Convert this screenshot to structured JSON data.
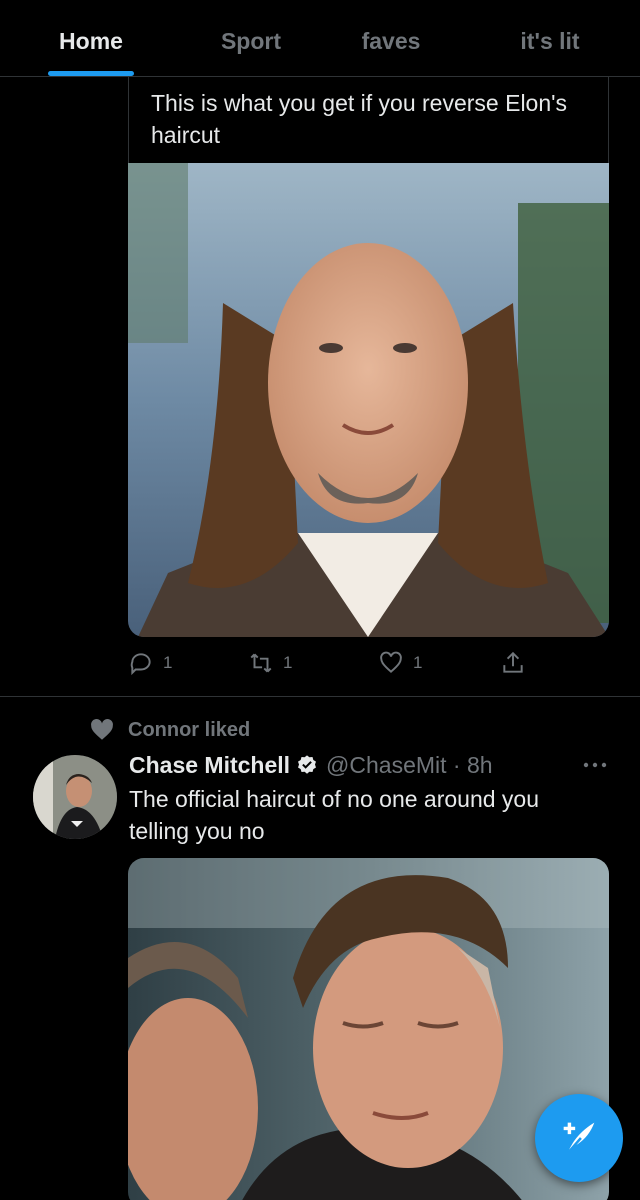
{
  "tabs": [
    {
      "label": "Home",
      "active": true
    },
    {
      "label": "Sport",
      "active": false
    },
    {
      "label": "faves",
      "active": false
    },
    {
      "label": "it's lit",
      "active": false
    }
  ],
  "tweet1": {
    "quote_text": "This is what you get if you reverse Elon's haircut",
    "media_description": "edited photo",
    "replies": "1",
    "retweets": "1",
    "likes": "1",
    "icons": [
      "reply-icon",
      "retweet-icon",
      "like-icon",
      "share-icon"
    ]
  },
  "tweet2": {
    "social_context": "Connor liked",
    "display_name": "Chase Mitchell",
    "verified": true,
    "handle_time": "@ChaseMit · 8h",
    "text": "The official haircut of no one around you telling you no"
  },
  "colors": {
    "background": "#000000",
    "accent": "#1d9bf0",
    "secondary_text": "#71767b",
    "primary_text": "#e7e9ea"
  }
}
